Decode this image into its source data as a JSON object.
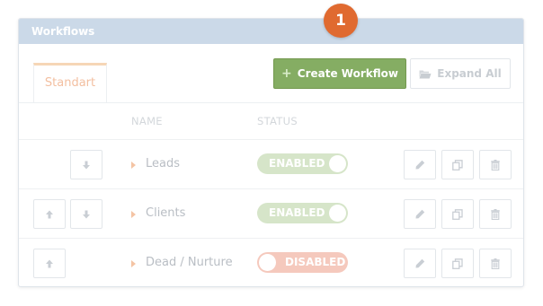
{
  "panel": {
    "title": "Workflows"
  },
  "badge": {
    "number": "1",
    "color": "#e06a30"
  },
  "tabs": [
    {
      "label": "Standart",
      "active": true
    }
  ],
  "toolbar": {
    "create_label": "Create Workflow",
    "create_icon": "plus-icon",
    "expand_label": "Expand All",
    "expand_icon": "folder-open-icon"
  },
  "table": {
    "columns": [
      "NAME",
      "STATUS"
    ],
    "rows": [
      {
        "name": "Leads",
        "status": "ENABLED",
        "enabled": true,
        "can_move_up": false,
        "can_move_down": true
      },
      {
        "name": "Clients",
        "status": "ENABLED",
        "enabled": true,
        "can_move_up": true,
        "can_move_down": true
      },
      {
        "name": "Dead / Nurture",
        "status": "DISABLED",
        "enabled": false,
        "can_move_up": true,
        "can_move_down": false
      }
    ],
    "row_actions": [
      "pencil-icon",
      "copy-icon",
      "trash-icon"
    ]
  },
  "colors": {
    "header": "#cbd9e8",
    "create_button": "#85ad63",
    "enabled": "#d6e5c9",
    "disabled": "#f5c9bd",
    "accent": "#e06a30"
  }
}
